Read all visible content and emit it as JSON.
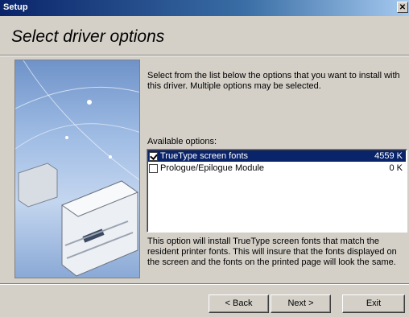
{
  "window": {
    "title": "Setup",
    "close_glyph": "✕"
  },
  "page": {
    "heading": "Select driver options",
    "intro": "Select from the list below the options that you want to install with this driver. Multiple options may be selected.",
    "available_label": "Available options:",
    "options": [
      {
        "label": "TrueType screen fonts",
        "size": "4559 K",
        "checked": true,
        "selected": true
      },
      {
        "label": "Prologue/Epilogue Module",
        "size": "0 K",
        "checked": false,
        "selected": false
      }
    ],
    "description": "This option will install TrueType screen fonts that match the resident printer fonts. This will insure that the fonts displayed on the screen and the fonts on the printed page will look the same."
  },
  "buttons": {
    "back": "< Back",
    "next": "Next >",
    "exit": "Exit"
  },
  "icons": {
    "checkbox_checked": "checkmark-icon",
    "close": "close-icon"
  },
  "colors": {
    "titlebar": "#0a246a",
    "selection": "#0a246a",
    "dialog_bg": "#d4d0c8"
  }
}
